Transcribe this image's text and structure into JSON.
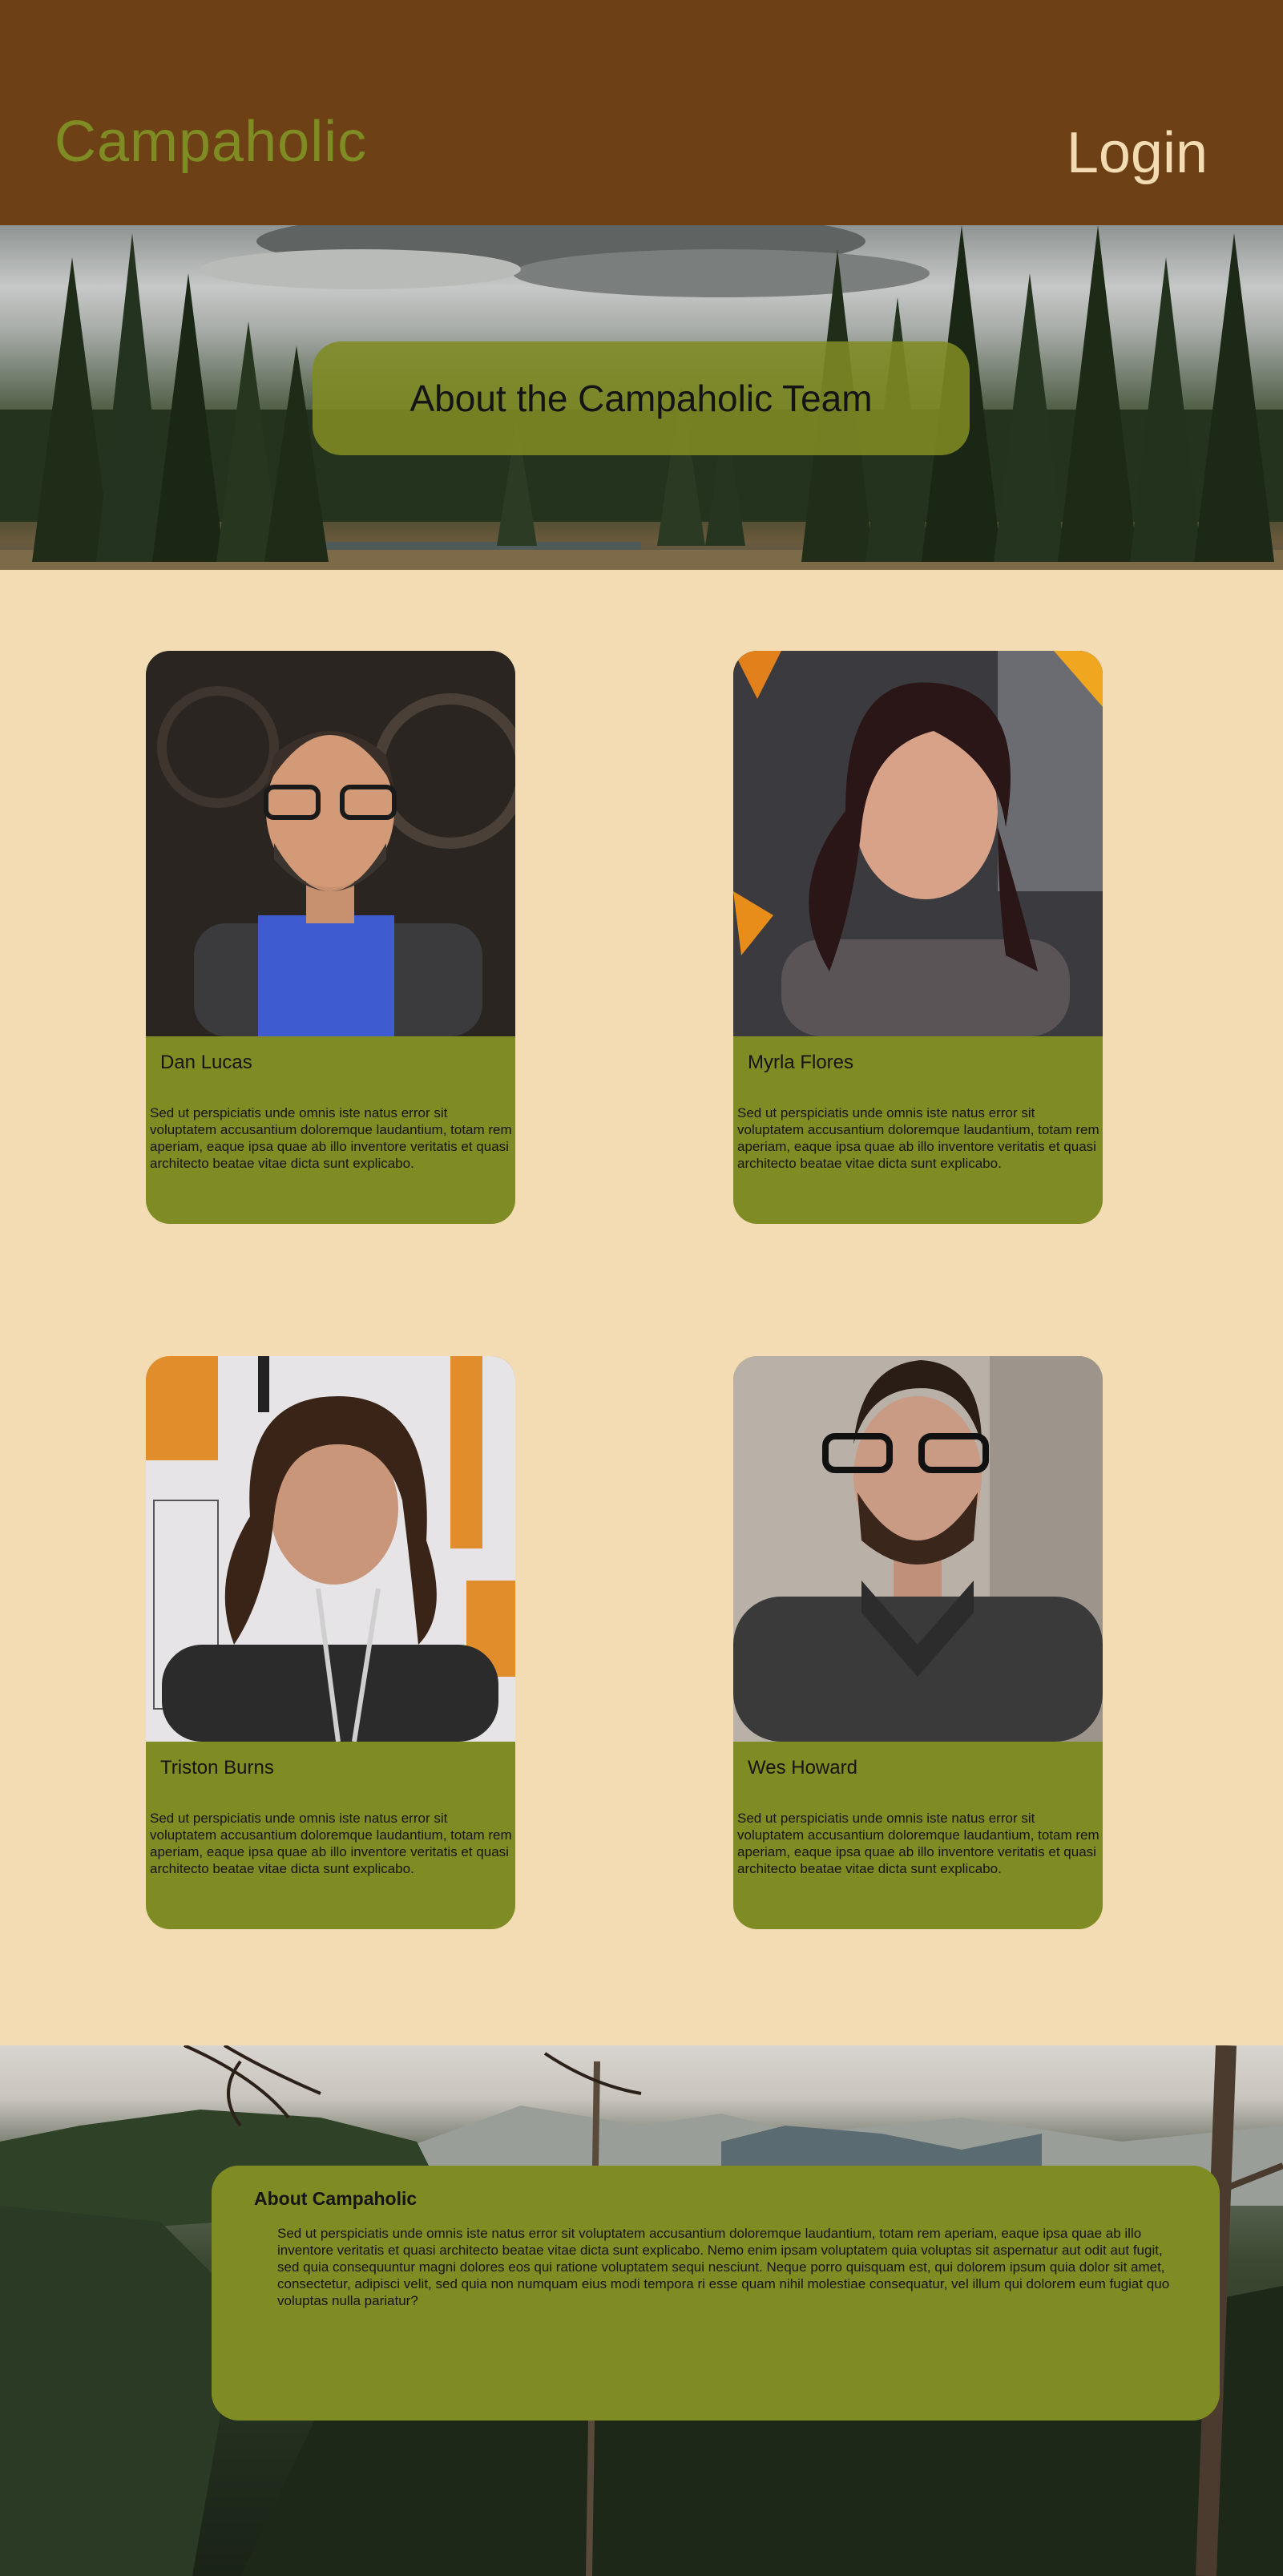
{
  "header": {
    "logo": "Campaholic",
    "login_label": "Login"
  },
  "hero": {
    "title": "About the Campaholic Team"
  },
  "team": [
    {
      "name": "Dan Lucas",
      "bio": "Sed ut perspiciatis unde omnis iste natus error sit voluptatem accusantium doloremque laudantium, totam rem aperiam, eaque ipsa quae ab illo inventore veritatis et quasi architecto beatae vitae dicta sunt explicabo."
    },
    {
      "name": "Myrla Flores",
      "bio": "Sed ut perspiciatis unde omnis iste natus error sit voluptatem accusantium doloremque laudantium, totam rem aperiam, eaque ipsa quae ab illo inventore veritatis et quasi architecto beatae vitae dicta sunt explicabo."
    },
    {
      "name": "Triston Burns",
      "bio": "Sed ut perspiciatis unde omnis iste natus error sit voluptatem accusantium doloremque laudantium, totam rem aperiam, eaque ipsa quae ab illo inventore veritatis et quasi architecto beatae vitae dicta sunt explicabo."
    },
    {
      "name": "Wes Howard",
      "bio": "Sed ut perspiciatis unde omnis iste natus error sit voluptatem accusantium doloremque laudantium, totam rem aperiam, eaque ipsa quae ab illo inventore veritatis et quasi architecto beatae vitae dicta sunt explicabo."
    }
  ],
  "about": {
    "title": "About Campaholic",
    "text": "Sed ut perspiciatis unde omnis iste natus error sit voluptatem accusantium doloremque laudantium, totam rem aperiam, eaque ipsa quae ab illo inventore veritatis et quasi architecto beatae vitae dicta sunt explicabo. Nemo enim ipsam voluptatem quia voluptas sit aspernatur aut odit aut fugit, sed quia consequuntur magni dolores eos qui ratione voluptatem sequi nesciunt. Neque porro quisquam est, qui dolorem ipsum quia dolor sit amet, consectetur, adipisci velit, sed quia non numquam eius modi tempora ri esse quam nihil molestiae consequatur, vel illum qui dolorem eum fugiat quo voluptas nulla pariatur?"
  },
  "colors": {
    "header_bg": "#6e4016",
    "page_bg": "#f3dcb3",
    "accent_green": "#7f8b23",
    "login_text": "#f3dcb3"
  }
}
